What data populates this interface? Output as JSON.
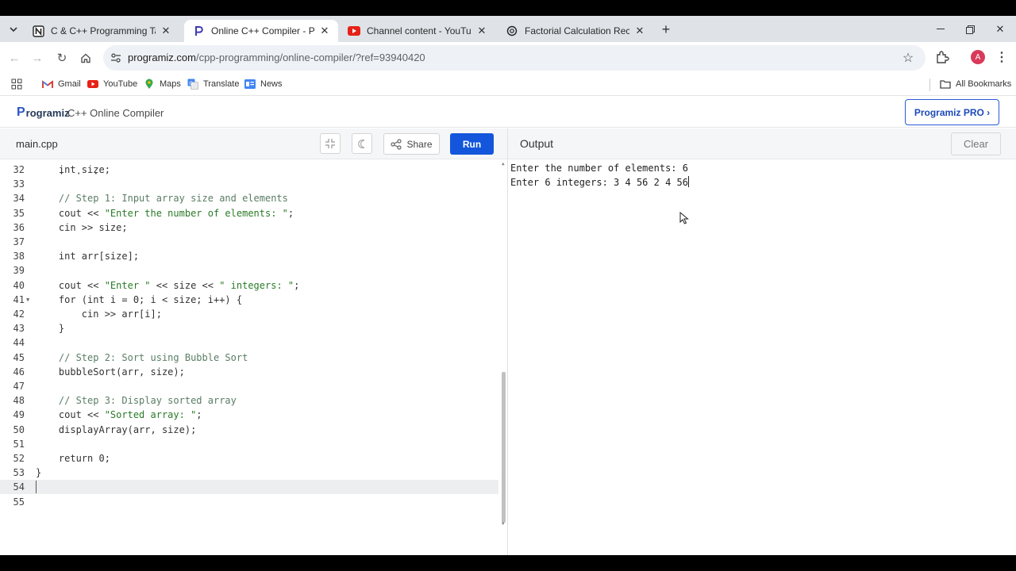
{
  "browser": {
    "tabs": [
      {
        "title": "C & C++ Programming Tasks –",
        "icon": "notion-icon",
        "active": false
      },
      {
        "title": "Online C++ Compiler - Program",
        "icon": "programiz-icon",
        "active": true
      },
      {
        "title": "Channel content - YouTube Stu",
        "icon": "youtube-studio-icon",
        "active": false
      },
      {
        "title": "Factorial Calculation Recursion",
        "icon": "chatgpt-icon",
        "active": false
      }
    ],
    "url_domain": "programiz.com",
    "url_path": "/cpp-programming/online-compiler/?ref=93940420",
    "profile_initial": "A",
    "bookmarks": [
      {
        "label": "Gmail",
        "icon": "gmail-icon"
      },
      {
        "label": "YouTube",
        "icon": "youtube-icon"
      },
      {
        "label": "Maps",
        "icon": "maps-icon"
      },
      {
        "label": "Translate",
        "icon": "translate-icon"
      },
      {
        "label": "News",
        "icon": "news-icon"
      }
    ],
    "all_bookmarks": "All Bookmarks"
  },
  "site": {
    "logo_text": "rogramiz",
    "logo_letter": "P",
    "name": "C++ Online Compiler",
    "pro_button": "Programiz PRO ›"
  },
  "editor": {
    "filename": "main.cpp",
    "share_label": "Share",
    "run_label": "Run",
    "current_line": 54,
    "lines": [
      {
        "n": "32",
        "text": "    int size;",
        "type": "code"
      },
      {
        "n": "33",
        "text": "",
        "type": "code"
      },
      {
        "n": "34",
        "text": "    // Step 1: Input array size and elements",
        "type": "comment"
      },
      {
        "n": "35",
        "pre": "    cout << ",
        "str": "\"Enter the number of elements: \"",
        "post": ";",
        "type": "mixed"
      },
      {
        "n": "36",
        "text": "    cin >> size;",
        "type": "code"
      },
      {
        "n": "37",
        "text": "",
        "type": "code"
      },
      {
        "n": "38",
        "text": "    int arr[size];",
        "type": "code"
      },
      {
        "n": "39",
        "text": "",
        "type": "code"
      },
      {
        "n": "40",
        "pre": "    cout << ",
        "str": "\"Enter \"",
        "mid": " << size << ",
        "str2": "\" integers: \"",
        "post": ";",
        "type": "mixed2"
      },
      {
        "n": "41",
        "text": "    for (int i = 0; i < size; i++) {",
        "type": "code",
        "fold": true
      },
      {
        "n": "42",
        "text": "        cin >> arr[i];",
        "type": "code"
      },
      {
        "n": "43",
        "text": "    }",
        "type": "code"
      },
      {
        "n": "44",
        "text": "",
        "type": "code"
      },
      {
        "n": "45",
        "text": "    // Step 2: Sort using Bubble Sort",
        "type": "comment"
      },
      {
        "n": "46",
        "text": "    bubbleSort(arr, size);",
        "type": "code"
      },
      {
        "n": "47",
        "text": "",
        "type": "code"
      },
      {
        "n": "48",
        "text": "    // Step 3: Display sorted array",
        "type": "comment"
      },
      {
        "n": "49",
        "pre": "    cout << ",
        "str": "\"Sorted array: \"",
        "post": ";",
        "type": "mixed"
      },
      {
        "n": "50",
        "text": "    displayArray(arr, size);",
        "type": "code"
      },
      {
        "n": "51",
        "text": "",
        "type": "code"
      },
      {
        "n": "52",
        "text": "    return 0;",
        "type": "code"
      },
      {
        "n": "53",
        "text": "}",
        "type": "code"
      },
      {
        "n": "54",
        "text": "",
        "type": "code"
      },
      {
        "n": "55",
        "text": "",
        "type": "code"
      }
    ]
  },
  "output": {
    "title": "Output",
    "clear_label": "Clear",
    "lines": [
      "Enter the number of elements: 6",
      "Enter 6 integers: 3 4 56 2 4 56"
    ]
  },
  "colors": {
    "run_button": "#1356db",
    "pro_border": "#2a5ad4",
    "string": "#2a7a27",
    "comment": "#5a7d64"
  }
}
